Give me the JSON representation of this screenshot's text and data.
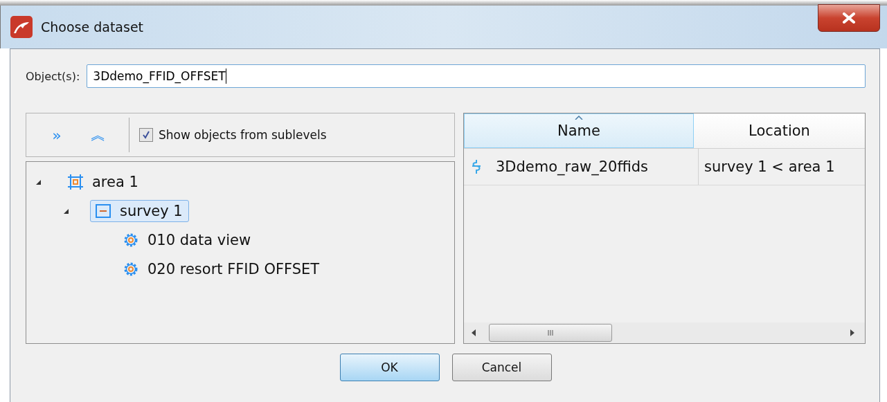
{
  "window": {
    "title": "Choose dataset"
  },
  "objects_field": {
    "label": "Object(s):",
    "value": "3Ddemo_FFID_OFFSET"
  },
  "toolbar": {
    "expand_all": "»",
    "collapse_all": "︽",
    "show_sublevels": {
      "label": "Show objects from sublevels",
      "checked": true
    }
  },
  "tree": [
    {
      "label": "area 1",
      "kind": "area",
      "expanded": true,
      "selected": false,
      "children": [
        {
          "label": "survey 1",
          "kind": "survey",
          "expanded": true,
          "selected": true,
          "children": [
            {
              "label": "010 data view",
              "kind": "flow",
              "selected": false
            },
            {
              "label": "020 resort FFID OFFSET",
              "kind": "flow",
              "selected": false
            }
          ]
        }
      ]
    }
  ],
  "table": {
    "columns": [
      {
        "label": "Name",
        "sorted": true
      },
      {
        "label": "Location",
        "sorted": false
      }
    ],
    "rows": [
      {
        "name": "3Ddemo_raw_20ffids",
        "location": "survey 1 < area 1"
      }
    ]
  },
  "buttons": [
    {
      "label": "OK",
      "default": true
    },
    {
      "label": "Cancel",
      "default": false
    }
  ]
}
